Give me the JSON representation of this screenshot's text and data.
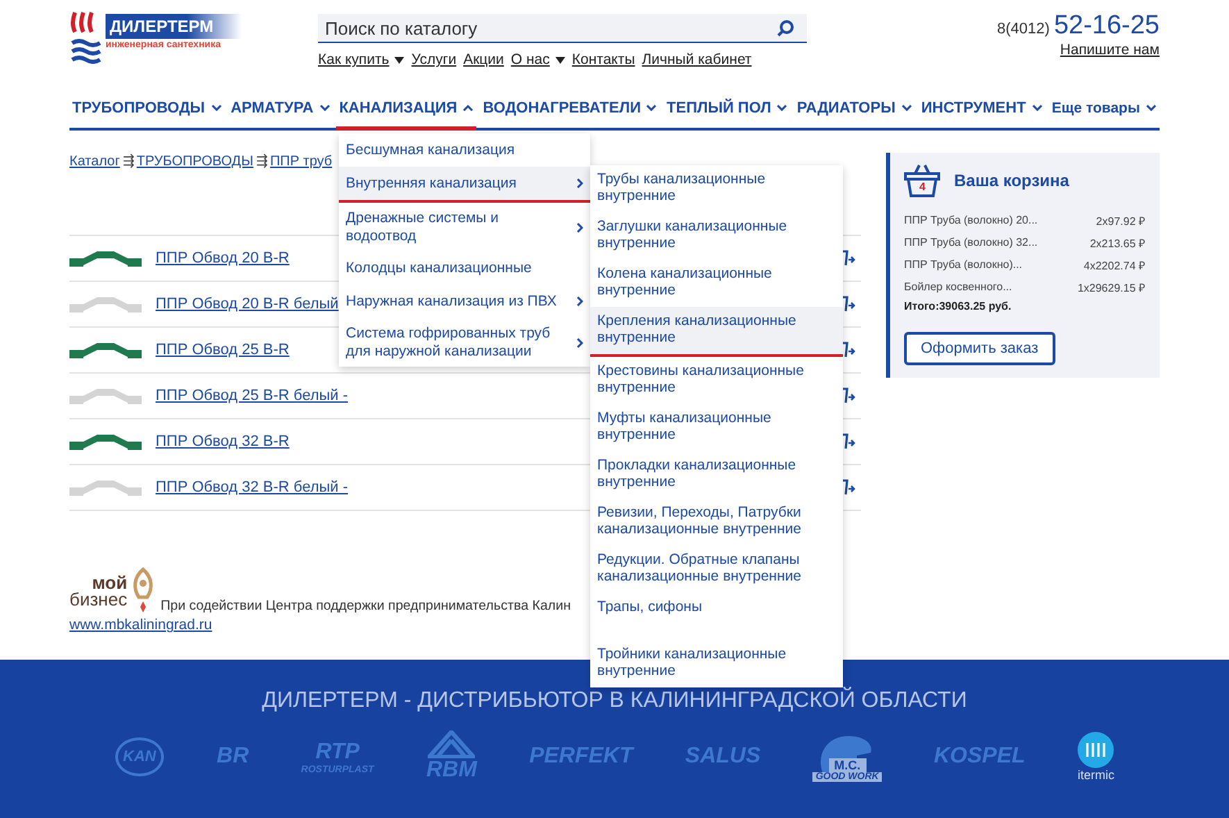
{
  "logo": {
    "name": "ДИЛЕРТЕРМ",
    "tagline": "инженерная сантехника"
  },
  "search": {
    "placeholder": "Поиск по каталогу"
  },
  "top_links": [
    {
      "label": "Как купить",
      "dropdown": true
    },
    {
      "label": "Услуги",
      "dropdown": false
    },
    {
      "label": "Акции",
      "dropdown": false
    },
    {
      "label": "О нас",
      "dropdown": true
    },
    {
      "label": "Контакты",
      "dropdown": false
    },
    {
      "label": "Личный кабинет",
      "dropdown": false
    }
  ],
  "contact": {
    "code": "8(4012)",
    "phone": "52-16-25",
    "write_link": "Напишите нам"
  },
  "nav": [
    {
      "label": "ТРУБОПРОВОДЫ",
      "selected": false
    },
    {
      "label": "АРМАТУРА",
      "selected": false
    },
    {
      "label": "КАНАЛИЗАЦИЯ",
      "selected": true
    },
    {
      "label": "ВОДОНАГРЕВАТЕЛИ",
      "selected": false
    },
    {
      "label": "ТЕПЛЫЙ ПОЛ",
      "selected": false
    },
    {
      "label": "РАДИАТОРЫ",
      "selected": false
    },
    {
      "label": "ИНСТРУМЕНТ",
      "selected": false
    },
    {
      "label": "Еще товары",
      "selected": false
    }
  ],
  "breadcrumb": {
    "separator": "⇶",
    "items": [
      "Каталог",
      "ТРУБОПРОВОДЫ",
      "ППР труб"
    ]
  },
  "products": [
    {
      "name": "ППР Обвод 20 B-R",
      "color": "#1f7a4d"
    },
    {
      "name": "ППР Обвод 20 B-R белый",
      "color": "#d4d4d4"
    },
    {
      "name": "ППР Обвод 25 B-R",
      "color": "#1f7a4d"
    },
    {
      "name": "ППР Обвод 25 B-R белый -",
      "color": "#d4d4d4"
    },
    {
      "name": "ППР Обвод 32 B-R",
      "color": "#1f7a4d"
    },
    {
      "name": "ППР Обвод 32 B-R белый -",
      "color": "#d4d4d4"
    }
  ],
  "dropdown": [
    {
      "label": "Бесшумная канализация",
      "selected": false,
      "has_children": false
    },
    {
      "label": "Внутренняя канализация",
      "selected": true,
      "has_children": true
    },
    {
      "label": "Дренажные системы и водоотвод",
      "selected": false,
      "has_children": true
    },
    {
      "label": "Колодцы канализационные",
      "selected": false,
      "has_children": false
    },
    {
      "label": "Наружная канализация из ПВХ",
      "selected": false,
      "has_children": true
    },
    {
      "label": "Система гофрированных труб для наружной канализации",
      "selected": false,
      "has_children": true
    }
  ],
  "submenu": [
    {
      "label": "Трубы канализационные внутренние",
      "selected": false
    },
    {
      "label": "Заглушки канализационные внутренние",
      "selected": false
    },
    {
      "label": "Колена канализационные внутренние",
      "selected": false
    },
    {
      "label": "Крепления канализационные внутренние",
      "selected": true
    },
    {
      "label": "Крестовины канализационные внутренние",
      "selected": false
    },
    {
      "label": "Муфты канализационные внутренние",
      "selected": false
    },
    {
      "label": "Прокладки канализационные внутренние",
      "selected": false
    },
    {
      "label": "Ревизии, Переходы, Патрубки канализационные внутренние",
      "selected": false
    },
    {
      "label": "Редукции. Обратные клапаны канализационные внутренние",
      "selected": false
    },
    {
      "label": "Трапы, сифоны",
      "selected": false
    },
    {
      "label": "Тройники канализационные внутренние",
      "selected": false
    }
  ],
  "cart": {
    "count": "4",
    "title": "Ваша корзина",
    "items": [
      {
        "name": "ППР Труба (волокно) 20...",
        "price": "2x97.92 ₽"
      },
      {
        "name": "ППР Труба (волокно) 32...",
        "price": "2x213.65 ₽"
      },
      {
        "name": "ППР Труба (волокно)...",
        "price": "4x2202.74 ₽"
      },
      {
        "name": "Бойлер косвенного...",
        "price": "1x29629.15 ₽"
      }
    ],
    "total": "Итого:39063.25 руб.",
    "button": "Оформить заказ"
  },
  "support": {
    "logo_top": "мой",
    "logo_bottom": "бизнес",
    "text": "При содействии Центра поддержки предпринимательства Калин",
    "link": "www.mbkaliningrad.ru"
  },
  "footer": {
    "title": "ДИЛЕРТЕРМ - ДИСТРИБЬЮТОР В КАЛИНИНГРАДСКОЙ ОБЛАСТИ",
    "partners": [
      {
        "kind": "ring",
        "name": "KAN"
      },
      {
        "kind": "plain",
        "name": "BR"
      },
      {
        "kind": "plain",
        "name": "RTP",
        "sub": "ROSTURPLAST"
      },
      {
        "kind": "triangle",
        "name": "RBM"
      },
      {
        "kind": "plain",
        "name": "PERFEKT"
      },
      {
        "kind": "plain",
        "name": "SALUS"
      },
      {
        "kind": "beaver",
        "name": "M.C.",
        "sub": "GOOD WORK"
      },
      {
        "kind": "plain",
        "name": "KOSPEL"
      },
      {
        "kind": "badge",
        "name": "itermic"
      }
    ]
  }
}
